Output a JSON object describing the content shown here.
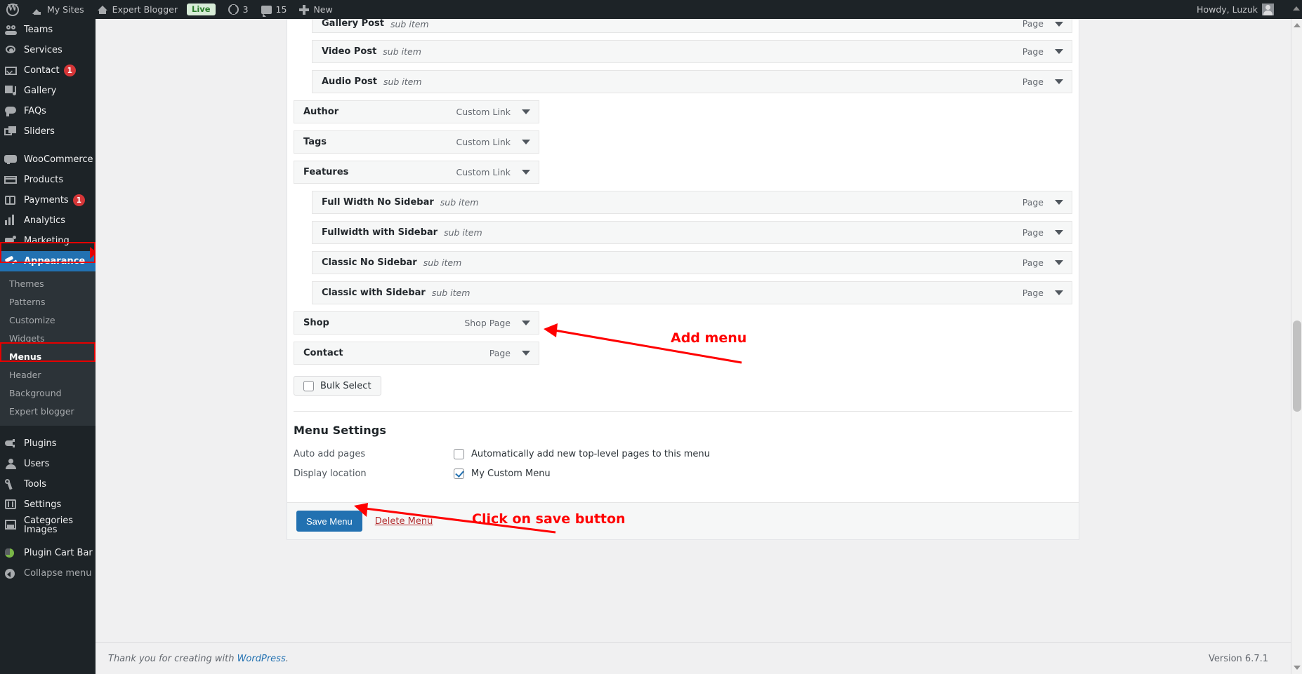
{
  "adminbar": {
    "logo_icon": "wordpress-logo-icon",
    "my_sites": "My Sites",
    "site_name": "Expert Blogger",
    "live_badge": "Live",
    "updates_count": "3",
    "comments_count": "15",
    "new_label": "New",
    "howdy": "Howdy, Luzuk"
  },
  "sidebar": {
    "items": [
      {
        "label": "Teams",
        "icon": "teams-icon",
        "badge": ""
      },
      {
        "label": "Services",
        "icon": "services-icon",
        "badge": ""
      },
      {
        "label": "Contact",
        "icon": "mail-icon",
        "badge": "1"
      },
      {
        "label": "Gallery",
        "icon": "gallery-icon",
        "badge": ""
      },
      {
        "label": "FAQs",
        "icon": "faq-icon",
        "badge": ""
      },
      {
        "label": "Sliders",
        "icon": "sliders-icon",
        "badge": ""
      },
      {
        "label": "WooCommerce",
        "icon": "woo-icon",
        "badge": ""
      },
      {
        "label": "Products",
        "icon": "products-icon",
        "badge": ""
      },
      {
        "label": "Payments",
        "icon": "payments-icon",
        "badge": "1"
      },
      {
        "label": "Analytics",
        "icon": "analytics-icon",
        "badge": ""
      },
      {
        "label": "Marketing",
        "icon": "marketing-icon",
        "badge": ""
      },
      {
        "label": "Appearance",
        "icon": "appearance-icon",
        "badge": ""
      },
      {
        "label": "Plugins",
        "icon": "plugins-icon",
        "badge": ""
      },
      {
        "label": "Users",
        "icon": "users-icon",
        "badge": ""
      },
      {
        "label": "Tools",
        "icon": "tools-icon",
        "badge": ""
      },
      {
        "label": "Settings",
        "icon": "settings-icon",
        "badge": ""
      },
      {
        "label": "Categories Images",
        "icon": "categories-images-icon",
        "badge": ""
      },
      {
        "label": "Plugin Cart Bar",
        "icon": "plugin-cart-bar-icon",
        "badge": ""
      },
      {
        "label": "Collapse menu",
        "icon": "collapse-icon",
        "badge": ""
      }
    ],
    "appearance_submenu": [
      "Themes",
      "Patterns",
      "Customize",
      "Widgets",
      "Menus",
      "Header",
      "Background",
      "Expert blogger"
    ],
    "current_item": "Appearance",
    "current_subitem": "Menus"
  },
  "menu_structure": {
    "rows": [
      {
        "title": "Gallery Post",
        "sub": "sub item",
        "type": "Page",
        "depth": 1,
        "clipped": true
      },
      {
        "title": "Video Post",
        "sub": "sub item",
        "type": "Page",
        "depth": 1,
        "clipped": false
      },
      {
        "title": "Audio Post",
        "sub": "sub item",
        "type": "Page",
        "depth": 1,
        "clipped": false
      },
      {
        "title": "Author",
        "sub": "",
        "type": "Custom Link",
        "depth": 0,
        "clipped": false
      },
      {
        "title": "Tags",
        "sub": "",
        "type": "Custom Link",
        "depth": 0,
        "clipped": false
      },
      {
        "title": "Features",
        "sub": "",
        "type": "Custom Link",
        "depth": 0,
        "clipped": false
      },
      {
        "title": "Full Width No Sidebar",
        "sub": "sub item",
        "type": "Page",
        "depth": 1,
        "clipped": false
      },
      {
        "title": "Fullwidth with Sidebar",
        "sub": "sub item",
        "type": "Page",
        "depth": 1,
        "clipped": false
      },
      {
        "title": "Classic No Sidebar",
        "sub": "sub item",
        "type": "Page",
        "depth": 1,
        "clipped": false
      },
      {
        "title": "Classic with Sidebar",
        "sub": "sub item",
        "type": "Page",
        "depth": 1,
        "clipped": false
      },
      {
        "title": "Shop",
        "sub": "",
        "type": "Shop Page",
        "depth": 0,
        "clipped": false
      },
      {
        "title": "Contact",
        "sub": "",
        "type": "Page",
        "depth": 0,
        "clipped": false
      }
    ],
    "bulk_select_label": "Bulk Select",
    "bulk_select_checked": false
  },
  "menu_settings": {
    "heading": "Menu Settings",
    "auto_add_label": "Auto add pages",
    "auto_add_option": "Automatically add new top-level pages to this menu",
    "auto_add_checked": false,
    "display_location_label": "Display location",
    "display_location_option": "My Custom Menu",
    "display_location_checked": true
  },
  "actions": {
    "save_label": "Save Menu",
    "delete_label": "Delete Menu"
  },
  "annotations": [
    {
      "text": "Add menu",
      "color": "#ff0000"
    },
    {
      "text": "Click on save button",
      "color": "#ff0000"
    }
  ],
  "footer": {
    "thanks_prefix": "Thank you for creating with ",
    "thanks_link": "WordPress",
    "thanks_suffix": ".",
    "version": "Version 6.7.1"
  }
}
